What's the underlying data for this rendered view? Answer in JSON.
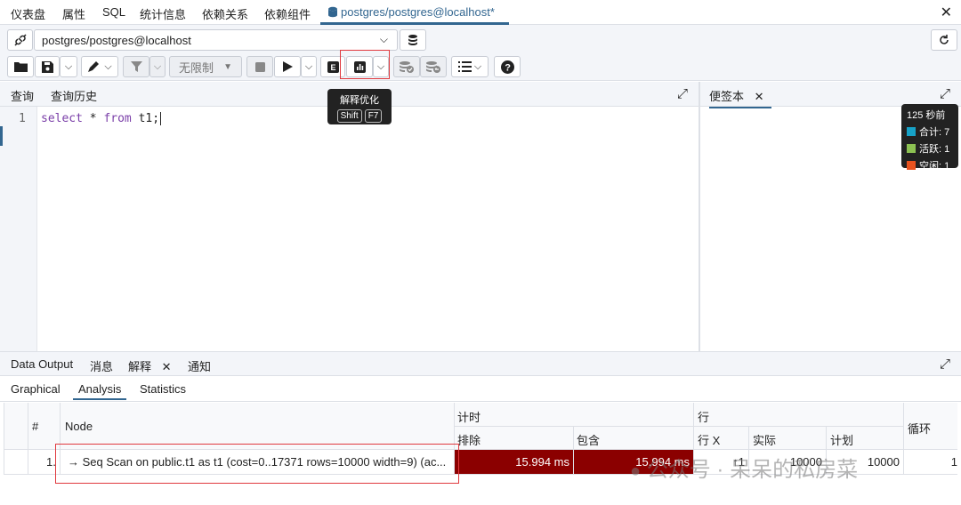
{
  "top_tabs": [
    {
      "label": "仪表盘"
    },
    {
      "label": "属性"
    },
    {
      "label": "SQL"
    },
    {
      "label": "统计信息"
    },
    {
      "label": "依赖关系"
    },
    {
      "label": "依赖组件"
    },
    {
      "label": "postgres/postgres@localhost*"
    }
  ],
  "connection": {
    "value": "postgres/postgres@localhost"
  },
  "toolbar": {
    "limit_label": "无限制"
  },
  "tooltip": {
    "title": "解释优化",
    "key1": "Shift",
    "key2": "F7"
  },
  "editor": {
    "tabs": [
      {
        "label": "查询"
      },
      {
        "label": "查询历史"
      }
    ],
    "line_number": "1",
    "code_kw1": "select",
    "code_mid": " * ",
    "code_kw2": "from",
    "code_tail": " t1;"
  },
  "scratch": {
    "label": "便签本"
  },
  "stats": {
    "title": "125 秒前",
    "total": "合计: 7",
    "active": "活跃: 1",
    "idle": "空闲: 1",
    "colors": {
      "total": "#17a2c7",
      "active": "#8cc152",
      "idle": "#e8521e"
    }
  },
  "output": {
    "tabs": [
      {
        "label": "Data Output"
      },
      {
        "label": "消息"
      },
      {
        "label": "解释"
      },
      {
        "label": "通知"
      }
    ],
    "subtabs": [
      {
        "label": "Graphical"
      },
      {
        "label": "Analysis"
      },
      {
        "label": "Statistics"
      }
    ],
    "headers": {
      "num": "#",
      "node": "Node",
      "timing": "计时",
      "exclusive": "排除",
      "inclusive": "包含",
      "rows": "行",
      "rows_x": "行 X",
      "actual": "实际",
      "plan": "计划",
      "loops": "循环"
    },
    "row": {
      "num": "1.",
      "node": "→  Seq Scan on public.t1 as t1 (cost=0..17371 rows=10000 width=9) (ac...",
      "exclusive": "15.994 ms",
      "inclusive": "15.994 ms",
      "rows_x": "↑1",
      "actual": "10000",
      "plan": "10000",
      "loops": "1"
    }
  },
  "watermark": "公众号 · 呆呆的私房菜"
}
